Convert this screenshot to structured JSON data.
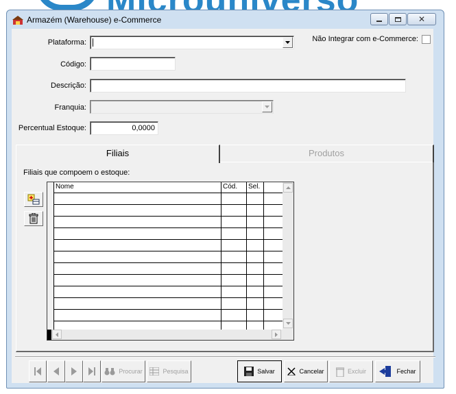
{
  "window": {
    "title": "Armazém (Warehouse) e-Commerce",
    "icon": "warehouse-app-icon",
    "controls": [
      "minimize-icon",
      "maximize-icon",
      "close-icon"
    ]
  },
  "background": {
    "brand_text": "Microuniverso"
  },
  "form": {
    "plataforma_label": "Plataforma:",
    "plataforma_value": "",
    "nao_integrar_label": "Não Integrar com e-Commerce:",
    "nao_integrar_checked": false,
    "codigo_label": "Código:",
    "codigo_value": "",
    "descricao_label": "Descrição:",
    "descricao_value": "",
    "franquia_label": "Franquia:",
    "franquia_value": "",
    "percentual_label": "Percentual Estoque:",
    "percentual_value": "0,0000"
  },
  "tabs": [
    {
      "label": "Filiais",
      "active": true
    },
    {
      "label": "Produtos",
      "active": false
    }
  ],
  "filiais": {
    "caption": "Filiais que compoem o estoque:",
    "columns": [
      "Nome",
      "Cód.",
      "Sel."
    ],
    "rows": [],
    "buttons": {
      "add_icon": "add-row-icon",
      "delete_icon": "trash-icon"
    }
  },
  "toolbar": {
    "nav_buttons": [
      "first-record-icon",
      "previous-record-icon",
      "next-record-icon",
      "last-record-icon"
    ],
    "procurar": "Procurar",
    "pesquisa": "Pesquisa",
    "salvar": "Salvar",
    "cancelar": "Cancelar",
    "excluir": "Excluir",
    "fechar": "Fechar"
  },
  "colors": {
    "window_frame": "#cfe0f1",
    "client_bg": "#f0f0f0",
    "brand": "#2a87c8"
  }
}
